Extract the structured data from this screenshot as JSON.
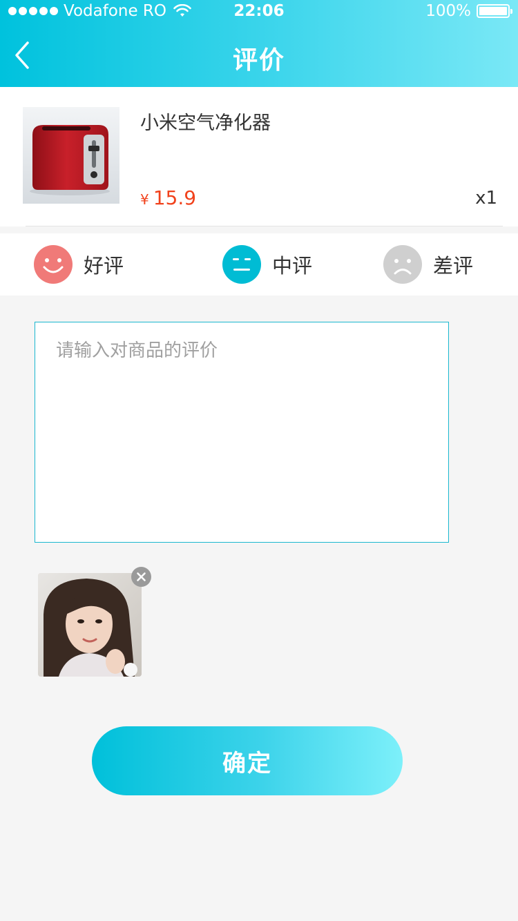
{
  "status_bar": {
    "carrier": "Vodafone RO",
    "time": "22:06",
    "battery": "100%"
  },
  "nav": {
    "title": "评价",
    "back_icon": "chevron-left-icon"
  },
  "product": {
    "name": "小米空气净化器",
    "currency": "¥",
    "price": "15.9",
    "quantity": "x1"
  },
  "rating": {
    "options": [
      {
        "label": "好评",
        "icon": "smile-face-icon",
        "color": "#f07a78"
      },
      {
        "label": "中评",
        "icon": "neutral-face-icon",
        "color": "#00bcd4"
      },
      {
        "label": "差评",
        "icon": "sad-face-icon",
        "color": "#cfcfcf"
      }
    ],
    "selected": "中评"
  },
  "review": {
    "placeholder": "请输入对商品的评价",
    "value": ""
  },
  "photos": {
    "remove_icon": "close-circle-icon"
  },
  "submit": {
    "label": "确定"
  },
  "colors": {
    "accent": "#00c2dd",
    "price": "#f1421c",
    "background": "#f5f5f5"
  }
}
